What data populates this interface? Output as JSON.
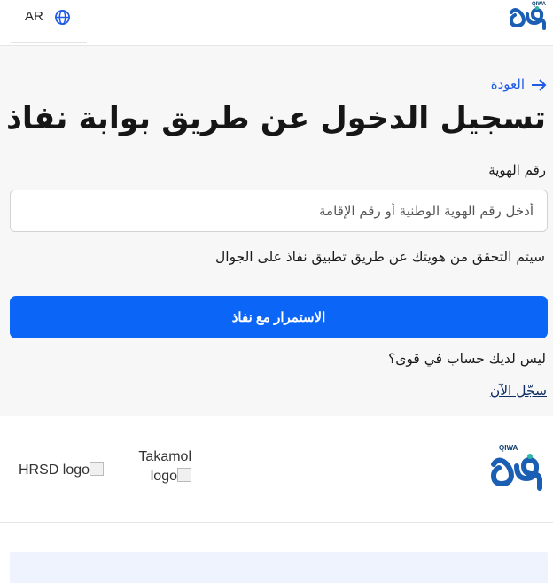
{
  "header": {
    "language_label": "AR",
    "logo_text": "QIWA"
  },
  "login": {
    "back_label": "العودة",
    "title": "تسجيل الدخول عن طريق بوابة نفاذ",
    "id_label": "رقم الهوية",
    "id_placeholder": "أدخل رقم الهوية الوطنية أو رقم الإقامة",
    "id_value": "",
    "info_text": "سيتم التحقق من هويتك عن طريق تطبيق نفاذ على الجوال",
    "continue_label": "الاستمرار مع نفاذ",
    "no_account_text": "ليس لديك حساب في قوى؟",
    "register_label": "سجّل الآن"
  },
  "footer": {
    "logo_text": "QIWA",
    "partner_logos": [
      {
        "alt": "Takamol logo"
      },
      {
        "alt": "HRSD logo"
      }
    ]
  },
  "colors": {
    "primary": "#0b66f7",
    "link": "#1e5be6",
    "brand": "#0b3b6e",
    "panel_bg": "#f7f7f7"
  }
}
